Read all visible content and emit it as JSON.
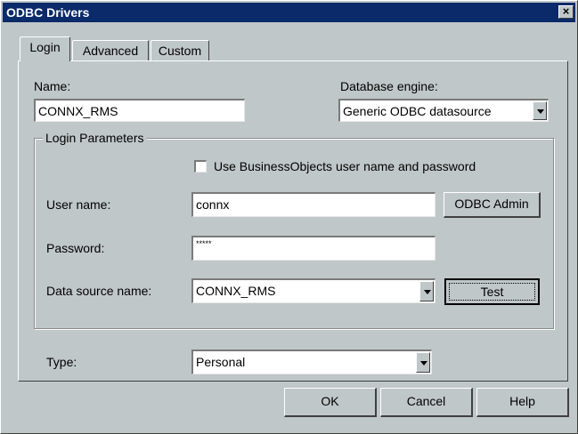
{
  "window": {
    "title": "ODBC Drivers",
    "close_label": "×"
  },
  "tabs": [
    {
      "label": "Login",
      "active": true
    },
    {
      "label": "Advanced",
      "active": false
    },
    {
      "label": "Custom",
      "active": false
    }
  ],
  "form": {
    "name_label": "Name:",
    "name_value": "CONNX_RMS",
    "db_engine_label": "Database engine:",
    "db_engine_value": "Generic ODBC datasource",
    "login_params_label": "Login Parameters",
    "use_bo_checkbox_label": "Use BusinessObjects user name and password",
    "use_bo_checked": false,
    "username_label": "User name:",
    "username_value": "connx",
    "odbc_admin_label": "ODBC Admin",
    "password_label": "Password:",
    "password_value": "*****",
    "dsn_label": "Data source name:",
    "dsn_value": "CONNX_RMS",
    "test_label": "Test",
    "type_label": "Type:",
    "type_value": "Personal"
  },
  "buttons": {
    "ok": "OK",
    "cancel": "Cancel",
    "help": "Help"
  },
  "colors": {
    "titlebar": "#0a2a6a",
    "face": "#c0c7c8"
  }
}
